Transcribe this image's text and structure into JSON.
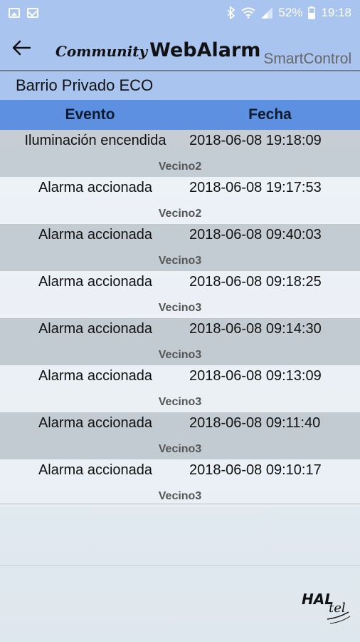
{
  "status_bar": {
    "battery": "52%",
    "time": "19:18",
    "icons": [
      "gallery-icon",
      "mail-icon",
      "bluetooth-icon",
      "wifi-icon",
      "signal-icon",
      "battery-icon"
    ]
  },
  "header": {
    "logo_community": "Community",
    "logo_webalarm": "WebAlarm",
    "logo_smartcontrol": "SmartControl"
  },
  "subtitle": "Barrio Privado ECO",
  "table": {
    "columns": [
      "Evento",
      "Fecha"
    ],
    "rows": [
      {
        "evento": "Iluminación encendida",
        "fecha": "2018-06-08 19:18:09",
        "vecino": "Vecino2"
      },
      {
        "evento": "Alarma accionada",
        "fecha": "2018-06-08 19:17:53",
        "vecino": "Vecino2"
      },
      {
        "evento": "Alarma accionada",
        "fecha": "2018-06-08 09:40:03",
        "vecino": "Vecino3"
      },
      {
        "evento": "Alarma accionada",
        "fecha": "2018-06-08 09:18:25",
        "vecino": "Vecino3"
      },
      {
        "evento": "Alarma accionada",
        "fecha": "2018-06-08 09:14:30",
        "vecino": "Vecino3"
      },
      {
        "evento": "Alarma accionada",
        "fecha": "2018-06-08 09:13:09",
        "vecino": "Vecino3"
      },
      {
        "evento": "Alarma accionada",
        "fecha": "2018-06-08 09:11:40",
        "vecino": "Vecino3"
      },
      {
        "evento": "Alarma accionada",
        "fecha": "2018-06-08 09:10:17",
        "vecino": "Vecino3"
      }
    ]
  },
  "footer": {
    "brand_hal": "HAL",
    "brand_tel": "tel"
  },
  "colors": {
    "header_bg": "#a9c4ee",
    "table_header_bg": "#5d90e0"
  }
}
